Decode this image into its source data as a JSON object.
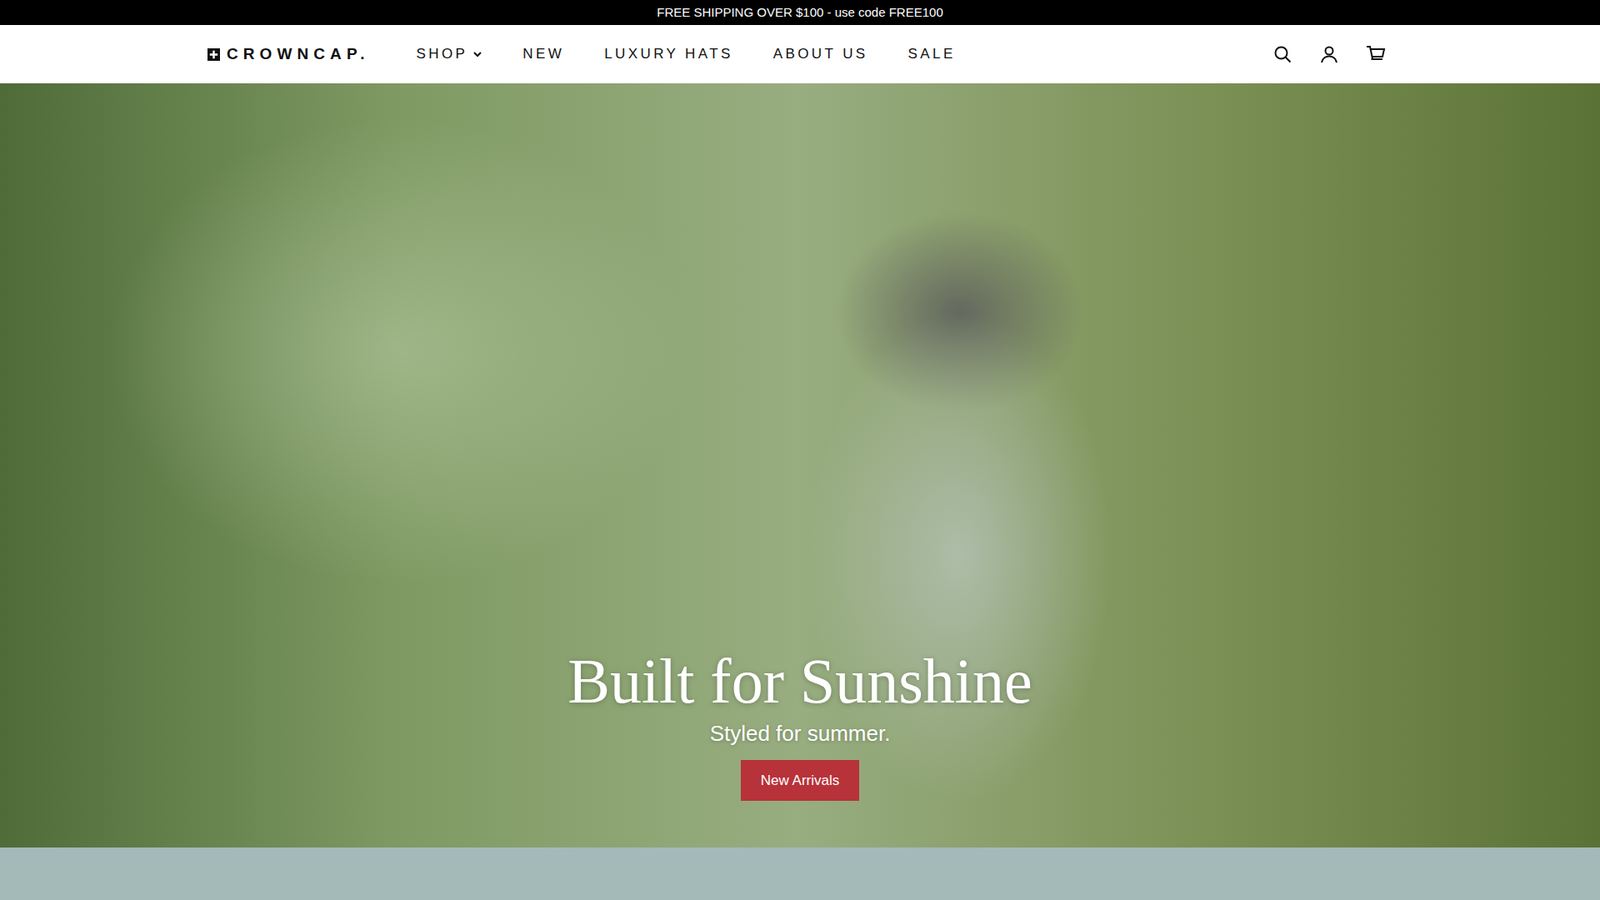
{
  "announcement": "FREE SHIPPING OVER $100 - use code FREE100",
  "logo": "CROWNCAP.",
  "nav": [
    {
      "label": "SHOP",
      "has_dropdown": true
    },
    {
      "label": "NEW",
      "has_dropdown": false
    },
    {
      "label": "LUXURY HATS",
      "has_dropdown": false
    },
    {
      "label": "ABOUT US",
      "has_dropdown": false
    },
    {
      "label": "SALE",
      "has_dropdown": false
    }
  ],
  "hero": {
    "title": "Built for Sunshine",
    "subtitle": "Styled for summer.",
    "button": "New Arrivals"
  }
}
